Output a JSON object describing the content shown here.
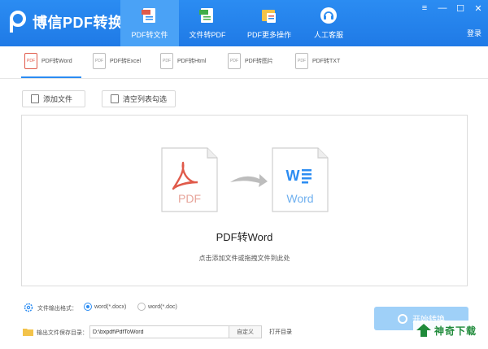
{
  "app": {
    "title": "博信PDF转换器",
    "login": "登录"
  },
  "nav": [
    {
      "label": "PDF转文件",
      "active": true
    },
    {
      "label": "文件转PDF",
      "active": false
    },
    {
      "label": "PDF更多操作",
      "active": false
    },
    {
      "label": "人工客服",
      "active": false
    }
  ],
  "subtabs": [
    {
      "label": "PDF转Word",
      "icon_text": "PDF",
      "active": true
    },
    {
      "label": "PDF转Excel",
      "icon_text": "PDF",
      "active": false
    },
    {
      "label": "PDF转Html",
      "icon_text": "PDF",
      "active": false
    },
    {
      "label": "PDF转图片",
      "icon_text": "PDF",
      "active": false
    },
    {
      "label": "PDF转TXT",
      "icon_text": "PDF",
      "active": false
    }
  ],
  "toolbar": {
    "add_file": "添加文件",
    "clear_list": "清空列表勾选"
  },
  "dropzone": {
    "source_icon_text": "PDF",
    "target_icon_text": "Word",
    "title": "PDF转Word",
    "hint": "点击添加文件或拖拽文件到此处"
  },
  "output": {
    "format_label": "文件输出格式：",
    "format_options": [
      {
        "label": "word(*.docx)",
        "selected": true
      },
      {
        "label": "word(*.doc)",
        "selected": false
      }
    ],
    "dir_label": "输出文件保存目录：",
    "dir_value": "D:\\bxpdf\\PdfToWord",
    "custom": "自定义",
    "open_dir": "打开目录"
  },
  "start": {
    "label": "开始转换"
  },
  "watermark": {
    "text": "神奇下载"
  },
  "colors": {
    "brand": "#2b8cf2",
    "pdf_red": "#e05a4a",
    "word_blue": "#2b8cf2"
  }
}
